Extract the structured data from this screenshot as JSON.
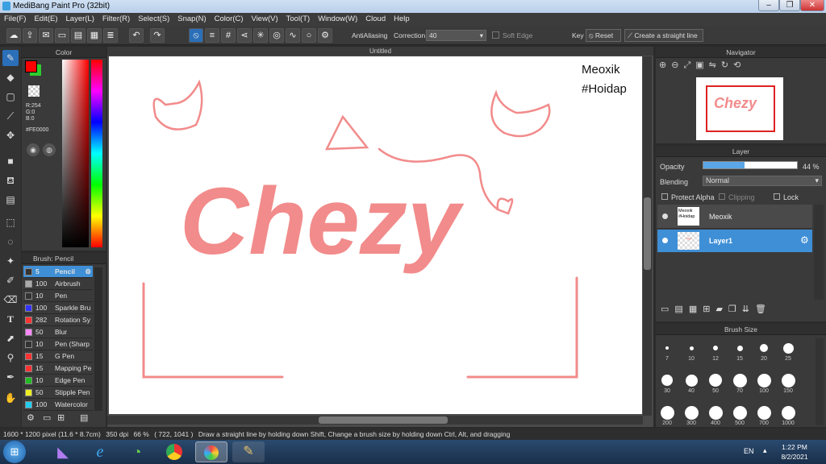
{
  "window": {
    "title": "MediBang Paint Pro (32bit)"
  },
  "menu": [
    "File(F)",
    "Edit(E)",
    "Layer(L)",
    "Filter(R)",
    "Select(S)",
    "Snap(N)",
    "Color(C)",
    "View(V)",
    "Tool(T)",
    "Window(W)",
    "Cloud",
    "Help"
  ],
  "toolbar": {
    "antialiasing": "AntiAliasing",
    "correction_label": "Correction",
    "correction_value": "40",
    "soft_edge": "Soft Edge",
    "key": "Key",
    "reset": "Reset",
    "straight_line": "Create a straight line"
  },
  "color_panel": {
    "title": "Color",
    "r": "R:254",
    "g": "G:0",
    "b": "B:0",
    "hex": "#FE0000",
    "primary": "#fe0000",
    "secondary": "#2ecc2e"
  },
  "brush_panel": {
    "title": "Brush: Pencil",
    "brushes": [
      {
        "size": "5",
        "name": "Pencil",
        "color": "#333333",
        "selected": true
      },
      {
        "size": "100",
        "name": "Airbrush",
        "color": "#aaaaaa"
      },
      {
        "size": "10",
        "name": "Pen",
        "color": "#333333"
      },
      {
        "size": "100",
        "name": "Sparkle Bru",
        "color": "#3333ff"
      },
      {
        "size": "282",
        "name": "Rotation Sy",
        "color": "#ff3333"
      },
      {
        "size": "50",
        "name": "Blur",
        "color": "#ff88ff"
      },
      {
        "size": "10",
        "name": "Pen (Sharp",
        "color": "#333333"
      },
      {
        "size": "15",
        "name": "G Pen",
        "color": "#ff3333"
      },
      {
        "size": "15",
        "name": "Mapping Pe",
        "color": "#ff3333"
      },
      {
        "size": "10",
        "name": "Edge Pen",
        "color": "#22bb22"
      },
      {
        "size": "50",
        "name": "Stipple Pen",
        "color": "#eeee22"
      },
      {
        "size": "100",
        "name": "Watercolor",
        "color": "#22ccee"
      }
    ]
  },
  "canvas": {
    "tab_title": "Untitled",
    "artwork_text": "Chezy",
    "watermark_line1": "Meoxik",
    "watermark_line2": "#Hoidap",
    "ink_color": "#f28b8b"
  },
  "navigator": {
    "title": "Navigator"
  },
  "layer_panel": {
    "title": "Layer",
    "opacity_label": "Opacity",
    "opacity_value": "44 %",
    "opacity_fraction": 0.44,
    "blending_label": "Blending",
    "blending_value": "Normal",
    "protect_alpha": "Protect Alpha",
    "clipping": "Clipping",
    "lock": "Lock",
    "layers": [
      {
        "name": "Meoxik",
        "thumb": "Meoxik #Hoidap",
        "selected": false
      },
      {
        "name": "Layer1",
        "selected": true
      }
    ]
  },
  "brush_size": {
    "title": "Brush Size",
    "sizes": [
      "7",
      "10",
      "12",
      "15",
      "20",
      "25",
      "30",
      "40",
      "50",
      "70",
      "100",
      "150",
      "200",
      "300",
      "400",
      "500",
      "700",
      "1000"
    ]
  },
  "status": {
    "dimensions": "1600 * 1200 pixel",
    "physical": "(11.6 * 8.7cm)",
    "dpi": "350 dpi",
    "zoom": "66 %",
    "coords": "( 722, 1041 )",
    "hint": "Draw a straight line by holding down Shift, Change a brush size by holding down Ctrl, Alt, and dragging"
  },
  "taskbar": {
    "lang": "EN",
    "time": "1:22 PM",
    "date": "8/2/2021"
  }
}
